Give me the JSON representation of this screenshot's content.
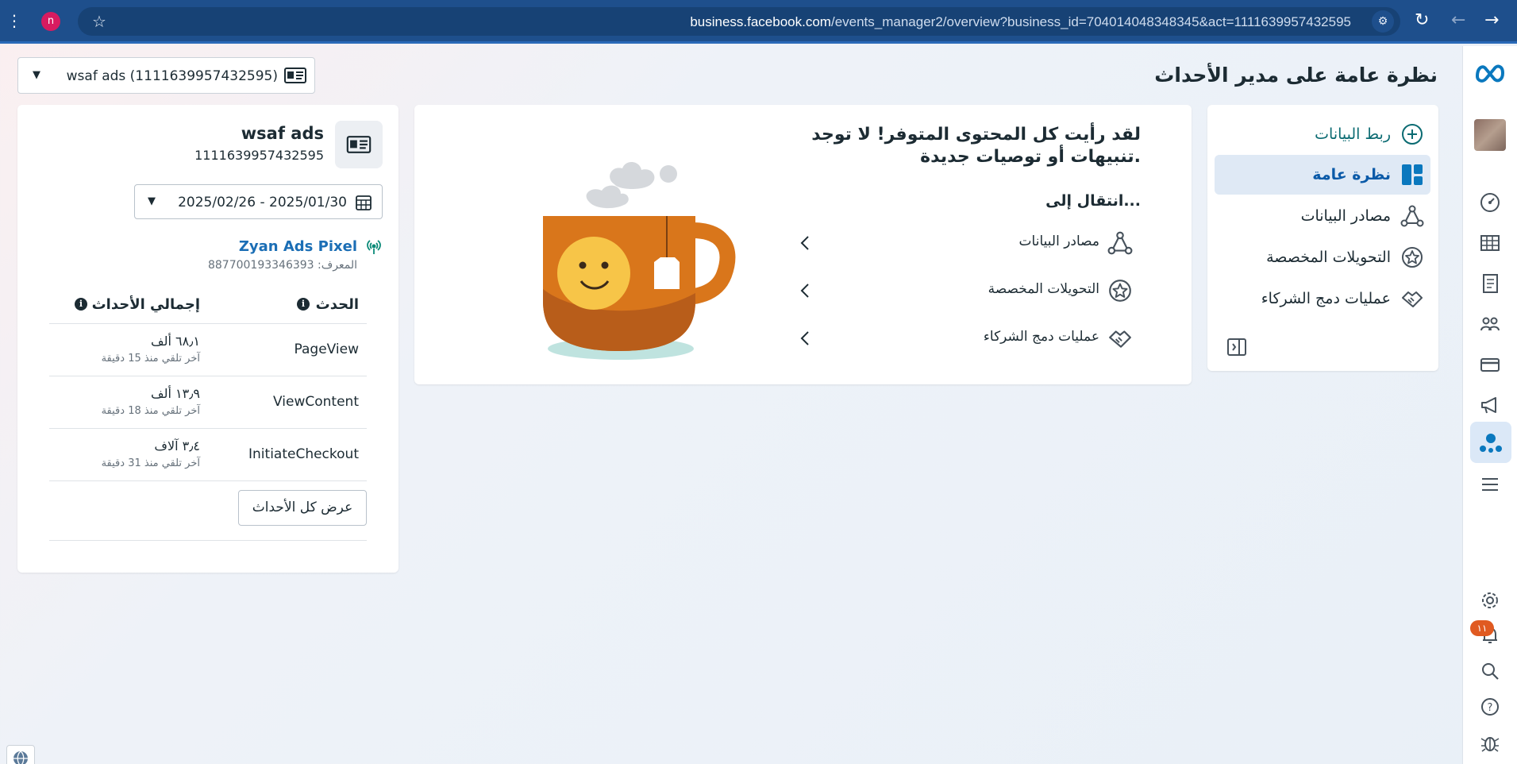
{
  "browser": {
    "profile_initial": "n",
    "url_host": "business.facebook.com",
    "url_path": "/events_manager2/overview?business_id=704014048348345&act=1111639957432595"
  },
  "page": {
    "title": "نظرة عامة على مدير الأحداث",
    "account_selector": "wsaf ads (1111639957432595)"
  },
  "nav": {
    "items": [
      {
        "label": "ربط البيانات",
        "icon": "plus-circle-icon"
      },
      {
        "label": "نظرة عامة",
        "icon": "overview-icon"
      },
      {
        "label": "مصادر البيانات",
        "icon": "data-sources-icon"
      },
      {
        "label": "التحويلات المخصصة",
        "icon": "custom-conversions-icon"
      },
      {
        "label": "عمليات دمج الشركاء",
        "icon": "partner-integrations-icon"
      }
    ]
  },
  "promo": {
    "title": "لقد رأيت كل المحتوى المتوفر! لا توجد تنبيهات أو توصيات جديدة.",
    "goto_label": "انتقال إلى...",
    "links": [
      {
        "label": "مصادر البيانات"
      },
      {
        "label": "التحويلات المخصصة"
      },
      {
        "label": "عمليات دمج الشركاء"
      }
    ]
  },
  "summary": {
    "account_name": "wsaf ads",
    "account_id": "1111639957432595",
    "date_range": "2025/02/26 - 2025/01/30",
    "pixel_name": "Zyan Ads Pixel",
    "pixel_id": "المعرف: 887700193346393",
    "col_event": "الحدث",
    "col_total": "إجمالي الأحداث",
    "events": [
      {
        "name": "PageView",
        "count": "٦٨٫١ ألف",
        "last": "آخر تلقي منذ 15 دقيقة"
      },
      {
        "name": "ViewContent",
        "count": "١٣٫٩ ألف",
        "last": "آخر تلقي منذ 18 دقيقة"
      },
      {
        "name": "InitiateCheckout",
        "count": "٣٫٤ آلاف",
        "last": "آخر تلقي منذ 31 دقيقة"
      }
    ],
    "view_all_label": "عرض كل الأحداث"
  },
  "rail": {
    "notifications_badge": "١١",
    "icons": [
      "meta-logo-icon",
      "dashboard-icon",
      "table-icon",
      "pages-icon",
      "people-icon",
      "billing-icon",
      "megaphone-icon",
      "events-manager-icon",
      "menu-icon",
      "settings-icon",
      "bell-icon",
      "search-icon",
      "help-icon",
      "bug-icon"
    ]
  },
  "colors": {
    "accent": "#0a78be",
    "browser_bar": "#1e4f8c",
    "badge": "#e05a21",
    "link": "#1b6eb5"
  }
}
